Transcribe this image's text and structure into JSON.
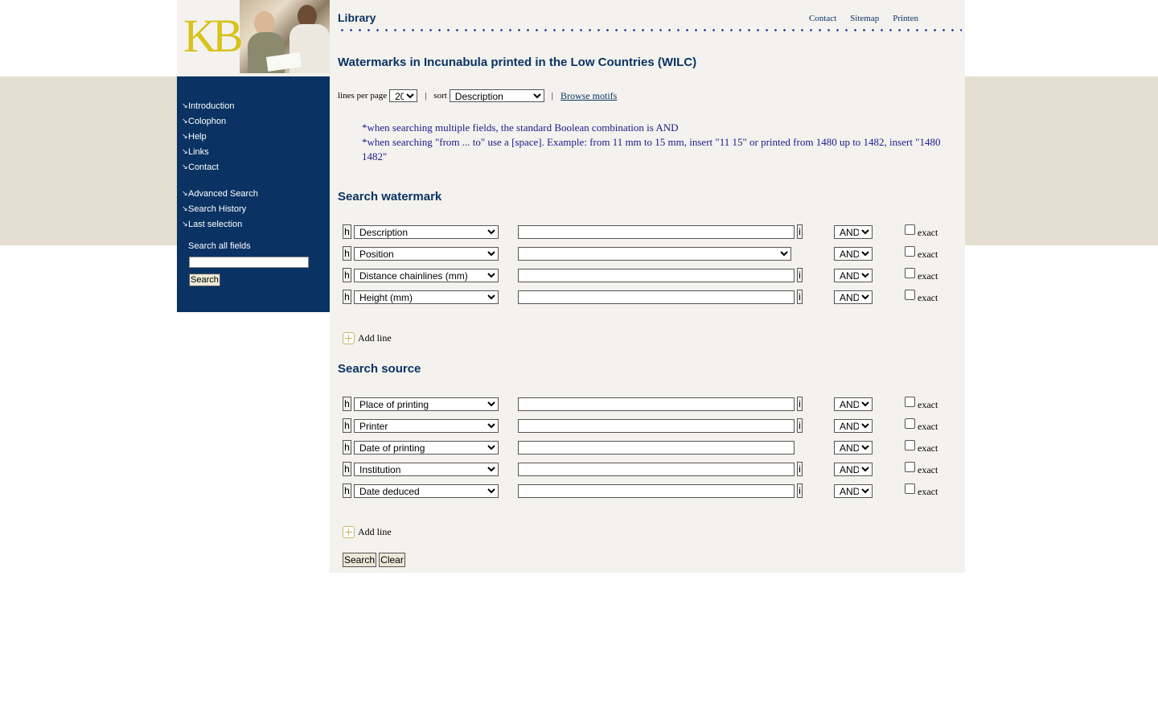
{
  "header": {
    "title": "Library",
    "links": [
      "Contact",
      "Sitemap",
      "Printen"
    ]
  },
  "sidebar": {
    "items": [
      "Introduction",
      "Colophon",
      "Help",
      "Links",
      "Contact"
    ],
    "items2": [
      "Advanced Search",
      "Search History",
      "Last selection"
    ],
    "search_label": "Search all fields",
    "search_button": "Search"
  },
  "main": {
    "heading": "Watermarks in Incunabula printed in the Low Countries (WILC)",
    "lines_label": "lines per page",
    "lines_value": "20",
    "sort_label": "sort",
    "sort_value": "Description",
    "browse_link": "Browse motifs",
    "note1": "*when searching multiple fields, the standard Boolean combination is AND",
    "note2": "*when searching \"from ... to\" use a [space].  Example: from 11 mm to 15 mm, insert \"11 15\" or printed from 1480 up to 1482, insert \"1480 1482\"",
    "h_label": "h",
    "i_label": "i",
    "exact_label": "exact",
    "add_line": "Add line",
    "watermark": {
      "heading": "Search watermark",
      "rows": [
        {
          "field": "Description",
          "op": "AND"
        },
        {
          "field": "Position",
          "op": "AND"
        },
        {
          "field": "Distance chainlines (mm)",
          "op": "AND"
        },
        {
          "field": "Height (mm)",
          "op": "AND"
        }
      ]
    },
    "source": {
      "heading": "Search source",
      "rows": [
        {
          "field": "Place of printing",
          "op": "AND"
        },
        {
          "field": "Printer",
          "op": "AND"
        },
        {
          "field": "Date of printing",
          "op": "AND"
        },
        {
          "field": "Institution",
          "op": "AND"
        },
        {
          "field": "Date deduced",
          "op": "AND"
        }
      ]
    },
    "search_button": "Search",
    "clear_button": "Clear"
  },
  "colors": {
    "navy": "#0a3363",
    "band": "#e4dfd0",
    "content_bg": "#f4f2ee",
    "note_text": "#1a1a8c",
    "logo_gold": "#d8c21c"
  }
}
